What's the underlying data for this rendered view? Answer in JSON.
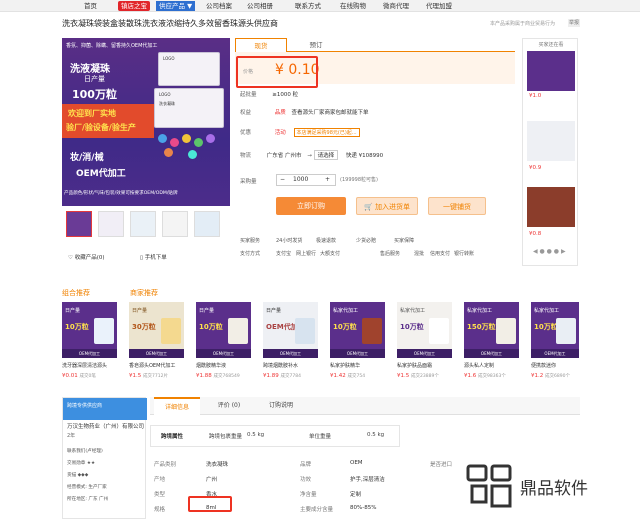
{
  "topnav": {
    "items": [
      "首页",
      "镇店之宝",
      "供应产品 ▼",
      "公司档案",
      "公司相册",
      "联系方式",
      "在线购物",
      "微商代理",
      "代理加盟"
    ]
  },
  "title": "洗衣凝珠袋装盒装散珠洗衣液浓缩持久多效留香珠源头供应商",
  "crumb": "本产品采购属于商业贸易行为",
  "crumb_btn": "举报",
  "main_image": {
    "header": "香氛、抑菌、除螨、留香持久OEM代加工",
    "line1": "洗液凝珠",
    "line2": "日产量",
    "line3": "100万粒",
    "banner1": "欢迎到厂实地",
    "banner2": "验厂/验设备/验生产",
    "line4": "妆/消/械",
    "line5": "OEM代加工",
    "footer": "产品颜色/形状/气味/包装/效果可按要求OEM/ODM/贴牌",
    "box_label": "LOGO",
    "box_sub": "洗衣凝珠"
  },
  "collect": "收藏产品(0)",
  "mobile": "手机下单",
  "tabs": {
    "active": "现货",
    "other": "预订"
  },
  "price": {
    "label": "价格",
    "value": "¥ 0.10"
  },
  "rows": {
    "moq_label": "起批量",
    "moq_value": "≥1000 粒",
    "benefit_label": "权益",
    "benefit_tag": "品质",
    "benefit_value": "查看源头厂家商家包邮就能下单",
    "promo_label": "优惠",
    "promo_tag": "活动",
    "promo_value": "本店满足采购98元(已)起...",
    "ship_label": "物流",
    "ship_from": "广东省 广州市",
    "ship_to": "请选择",
    "ship_express": "快递 ¥108990",
    "qty_label": "采购量",
    "qty_note": "(199998粒可售)"
  },
  "qty": {
    "minus": "−",
    "value": "1000",
    "plus": "+"
  },
  "buttons": {
    "order": "立即订购",
    "cart": "加入进货单",
    "quick": "一键铺货"
  },
  "service": {
    "label1": "买家服务",
    "s1": "24小时发货",
    "s2": "极速退款",
    "s3": "少货必赔",
    "s4": "买家保障",
    "label2": "支付方式",
    "p1": "支付宝",
    "p2": "网上银行",
    "p3": "大额支付",
    "label3": "售后服务",
    "a1": "混批",
    "a2": "信用支付",
    "a3": "银行转账"
  },
  "side": {
    "header": "买家还在看",
    "prices": [
      "¥1.0",
      "¥0.9",
      "¥0.8"
    ]
  },
  "sections": {
    "combo": "组合推荐",
    "shop_rec": "商家推荐"
  },
  "cards": [
    {
      "t1": "日产量",
      "big": "10万粒",
      "foot": "OEM代加工",
      "name": "洗牙器深层清洁源头",
      "price": "¥0.01",
      "sold": "成交0笔"
    },
    {
      "t1": "日产量",
      "big": "30万粒",
      "foot": "OEM代加工",
      "name": "香皂源头OEM代加工",
      "price": "¥1.5",
      "sold": "成交7712片"
    },
    {
      "t1": "日产量",
      "big": "10万粒",
      "foot": "OEM代加工",
      "name": "烟酰胺精华液",
      "price": "¥1.88",
      "sold": "成交768549"
    },
    {
      "t1": "日产量",
      "big": "OEM代加工",
      "foot": "OEM代加工",
      "name": "跨境烟酰胺补水",
      "price": "¥1.89",
      "sold": "成交7784"
    },
    {
      "t1": "私家代加工",
      "big": "10万粒",
      "foot": "OEM代加工",
      "name": "私家护肤精华",
      "price": "¥1.42",
      "sold": "成交754"
    },
    {
      "t1": "私家代加工",
      "big": "10万粒",
      "foot": "OEM代加工",
      "name": "私家护肤品面霜",
      "price": "¥1.5",
      "sold": "成交23889个"
    },
    {
      "t1": "私家代加工",
      "big": "150万粒",
      "foot": "OEM代加工",
      "name": "源头私人定制",
      "price": "¥1.6",
      "sold": "成交98363个"
    },
    {
      "t1": "私家代加工",
      "big": "10万粒",
      "foot": "OEM代加工",
      "name": "便携款迷你",
      "price": "¥1.2",
      "sold": "成交6890个"
    }
  ],
  "shop": {
    "header": "跨境专供供应商",
    "name": "万汉生物药业（广州）有限公司",
    "years": "2年",
    "l1": "联系我们(卢经理)",
    "l2": "交易勋章 ★★",
    "l3": "货描 ◆◆◆",
    "l4": "经营模式: 生产厂家",
    "l5": "所在地区: 广东 广州"
  },
  "dtabs": {
    "t1": "详细信息",
    "t2": "评价 (0)",
    "t3": "订购说明"
  },
  "attr": {
    "title": "跨境属性",
    "k1": "跨境包裹重量",
    "v1": "0.5 kg",
    "k2": "单位重量",
    "v2": "0.5 kg"
  },
  "specs": {
    "k1": "产品类别",
    "v1": "洗衣凝珠",
    "k2": "产地",
    "v2": "广州",
    "k3": "类型",
    "v3": "香水",
    "k4": "规格",
    "v4": "8ml",
    "k5": "品牌",
    "v5": "OEM",
    "k6": "功效",
    "v6": "护手,深层清洁",
    "k7": "净含量",
    "v7": "定制",
    "k8": "主要成分含量",
    "v8": "80%-85%",
    "k9": "是否进口",
    "v9": ""
  },
  "watermark": "鼎品软件"
}
